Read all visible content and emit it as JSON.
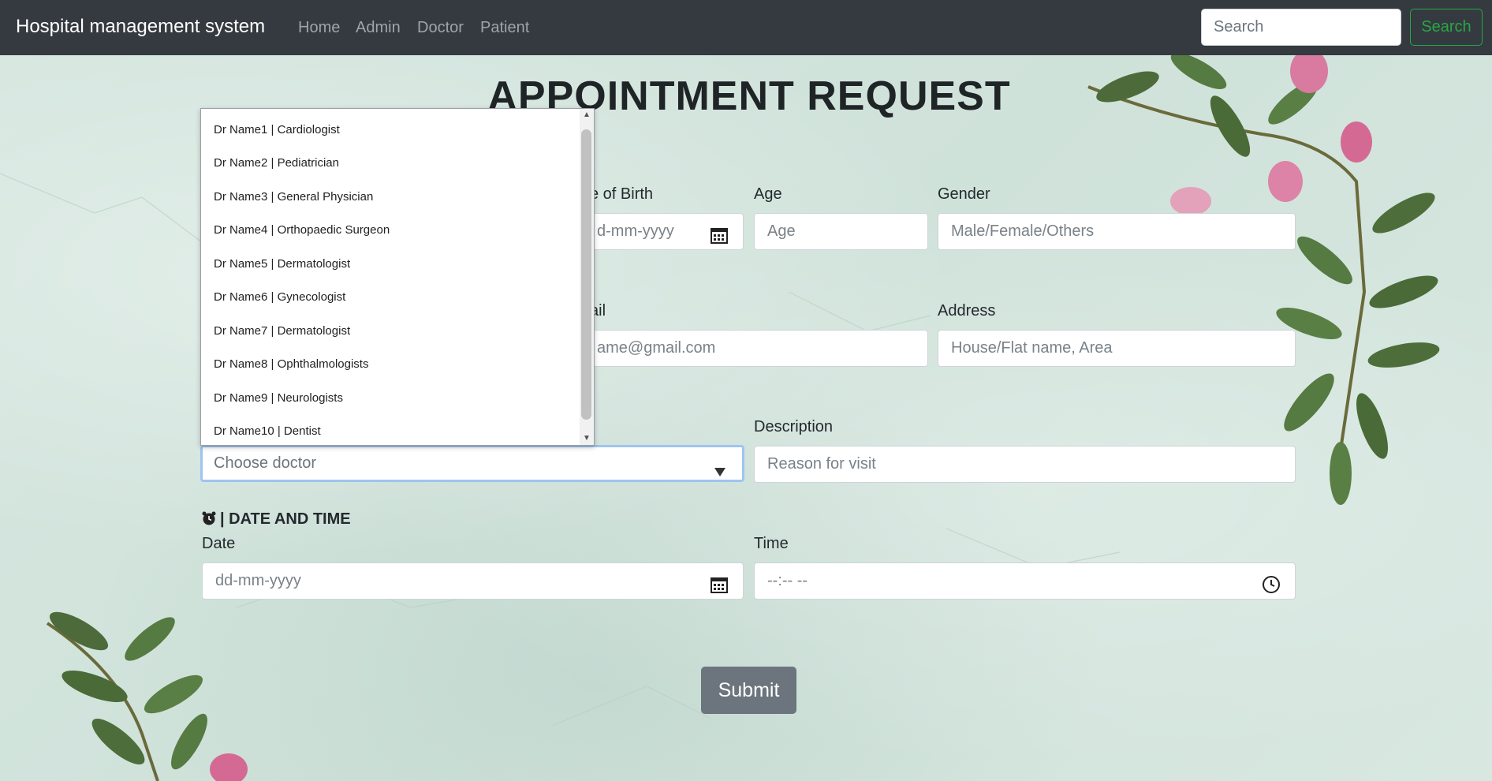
{
  "navbar": {
    "brand": "Hospital management system",
    "links": [
      "Home",
      "Admin",
      "Doctor",
      "Patient"
    ],
    "search_placeholder": "Search",
    "search_button": "Search"
  },
  "page": {
    "title": "APPOINTMENT REQUEST"
  },
  "form": {
    "dob": {
      "label": "e of Birth",
      "placeholder": "d-mm-yyyy"
    },
    "age": {
      "label": "Age",
      "placeholder": "Age"
    },
    "gender": {
      "label": "Gender",
      "placeholder": "Male/Female/Others"
    },
    "email": {
      "label": "ail",
      "placeholder": "ame@gmail.com"
    },
    "address": {
      "label": "Address",
      "placeholder": "House/Flat name, Area"
    },
    "doctor": {
      "placeholder": "Choose doctor"
    },
    "description": {
      "label": "Description",
      "placeholder": "Reason for visit"
    },
    "datetime_section": "| DATE AND TIME",
    "date": {
      "label": "Date",
      "placeholder": "dd-mm-yyyy"
    },
    "time": {
      "label": "Time",
      "placeholder": "--:-- --"
    },
    "submit": "Submit"
  },
  "doctor_dropdown": {
    "options": [
      "Dr Name1 | Cardiologist",
      "Dr Name2 | Pediatrician",
      "Dr Name3 | General Physician",
      "Dr Name4 | Orthopaedic Surgeon",
      "Dr Name5 | Dermatologist",
      "Dr Name6 | Gynecologist",
      "Dr Name7 | Dermatologist",
      "Dr Name8 | Ophthalmologists",
      "Dr Name9 | Neurologists",
      "Dr Name10 | Dentist"
    ]
  },
  "icons": {
    "calendar": "calendar-icon",
    "clock": "clock-icon",
    "alarm": "alarm-clock-icon",
    "dropdown": "caret-down-icon"
  }
}
